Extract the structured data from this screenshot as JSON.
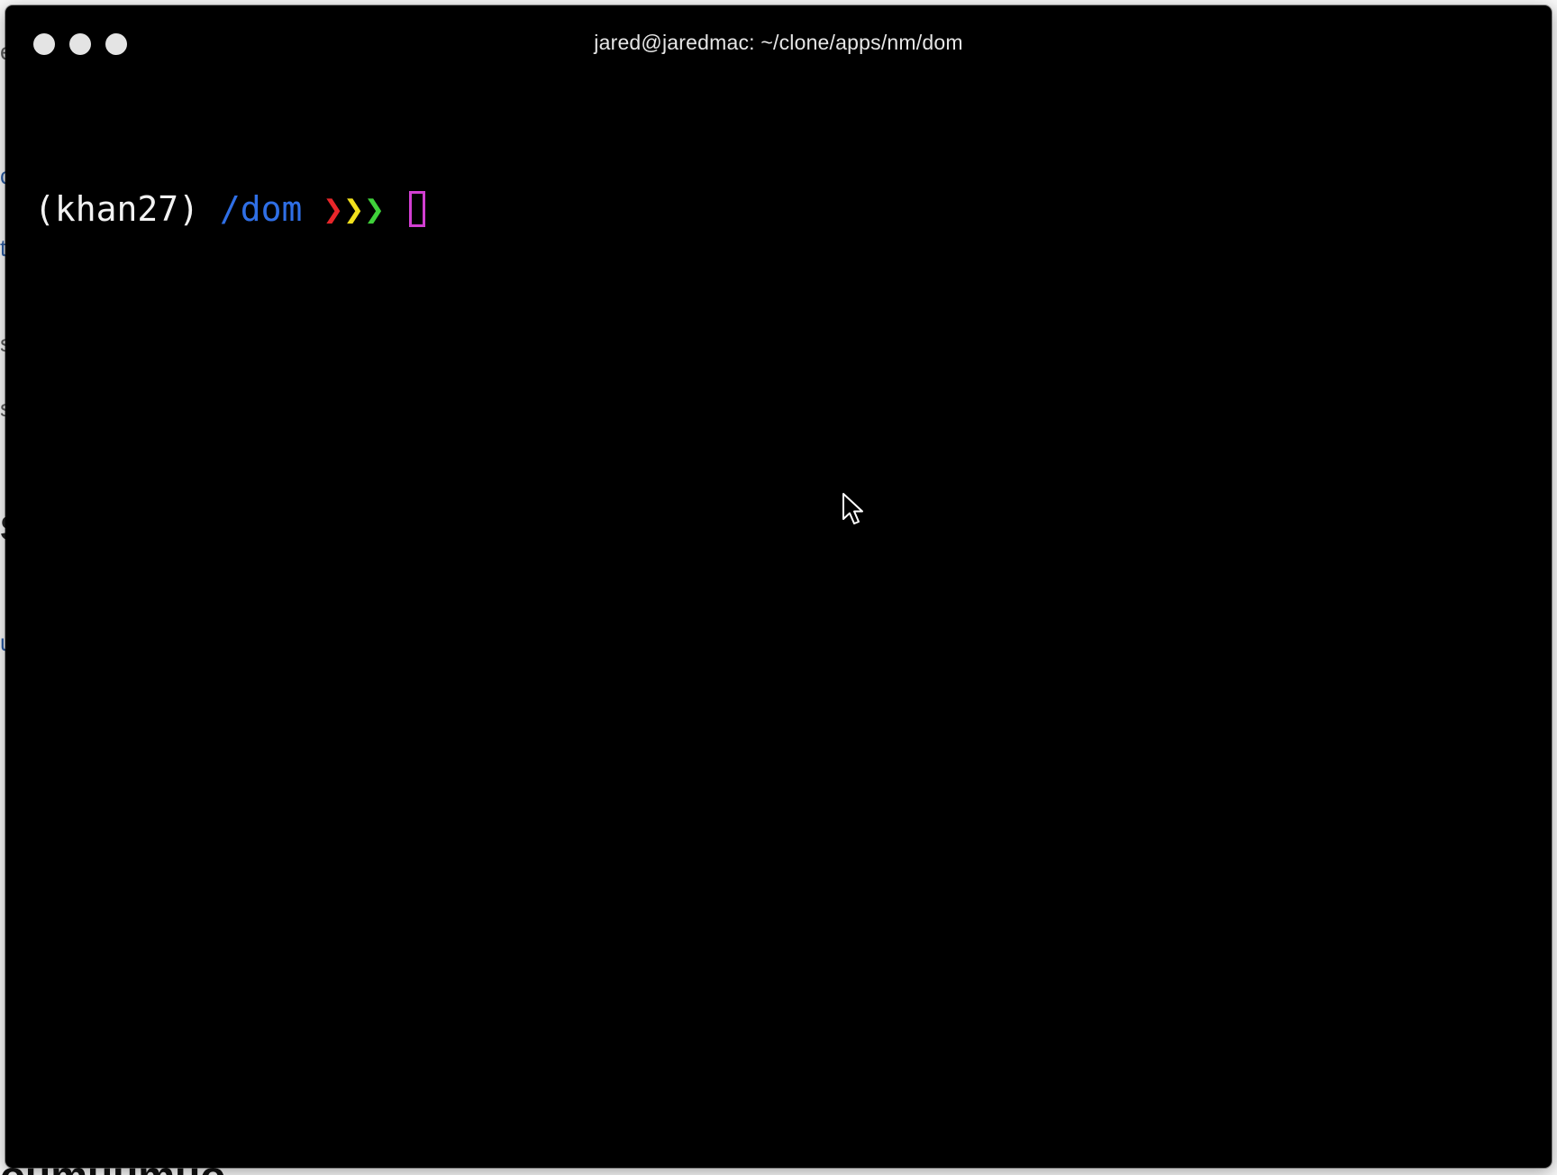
{
  "window": {
    "title": "jared@jaredmac: ~/clone/apps/nm/dom",
    "buttons": [
      "close",
      "minimize",
      "zoom"
    ]
  },
  "terminal": {
    "prompt": {
      "env": "(khan27)",
      "cwd": "/dom",
      "chevrons": [
        {
          "glyph": "❯",
          "color": "#e8262a"
        },
        {
          "glyph": "❯",
          "color": "#f2e11c"
        },
        {
          "glyph": "❯",
          "color": "#3fd13a"
        }
      ],
      "cursor_color": "#d23fd2"
    }
  },
  "colors": {
    "terminal_bg": "#000000",
    "cwd": "#2f6fe6",
    "title_text": "#e6e6e6"
  },
  "icons": {
    "pointer": "mouse-pointer-icon"
  }
}
